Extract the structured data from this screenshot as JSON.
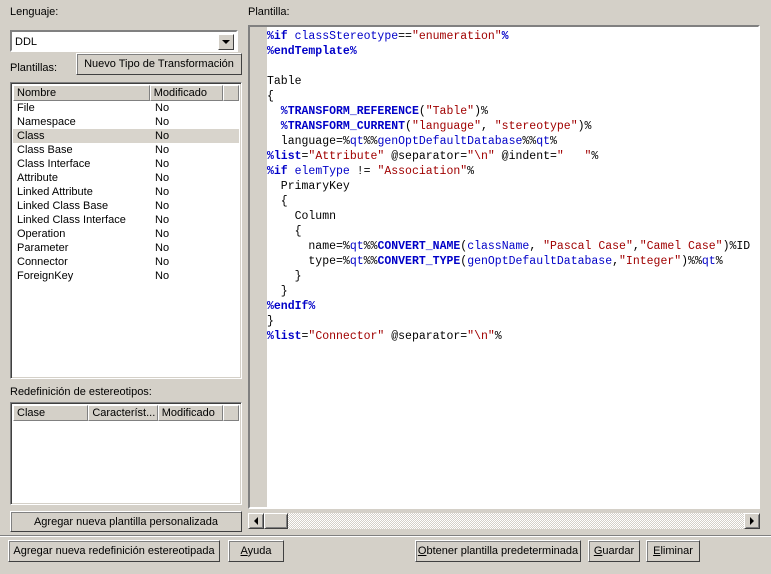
{
  "window": {
    "background_color": "#d4d0c8",
    "accent_text_color": "#000000"
  },
  "left_panel": {
    "language_label": "Lenguaje:",
    "language_combo": {
      "value": "DDL",
      "placeholder": "",
      "arrow_icon": "chevron-down-icon"
    },
    "templates_label": "Plantillas:",
    "new_transform_type_button": "Nuevo Tipo de Transformación",
    "templates_list": {
      "columns": [
        "Nombre",
        "Modificado",
        ""
      ],
      "selected_index": 2,
      "rows": [
        {
          "name": "File",
          "modified": "No"
        },
        {
          "name": "Namespace",
          "modified": "No"
        },
        {
          "name": "Class",
          "modified": "No"
        },
        {
          "name": "Class Base",
          "modified": "No"
        },
        {
          "name": "Class Interface",
          "modified": "No"
        },
        {
          "name": "Attribute",
          "modified": "No"
        },
        {
          "name": "Linked Attribute",
          "modified": "No"
        },
        {
          "name": "Linked Class Base",
          "modified": "No"
        },
        {
          "name": "Linked Class Interface",
          "modified": "No"
        },
        {
          "name": "Operation",
          "modified": "No"
        },
        {
          "name": "Parameter",
          "modified": "No"
        },
        {
          "name": "Connector",
          "modified": "No"
        },
        {
          "name": "ForeignKey",
          "modified": "No"
        }
      ]
    },
    "stereotype_label": "Redefinición de estereotipos:",
    "stereotype_list": {
      "columns": [
        "Clase",
        "Característ...",
        "Modificado",
        ""
      ],
      "rows": []
    },
    "add_custom_template_button": "Agregar nueva plantilla personalizada"
  },
  "right_panel": {
    "template_label": "Plantilla:",
    "editor": {
      "lines": [
        [
          {
            "t": "%if ",
            "c": "kw"
          },
          {
            "t": "classStereotype",
            "c": "var"
          },
          {
            "t": "==",
            "c": "pl"
          },
          {
            "t": "\"enumeration\"",
            "c": "str"
          },
          {
            "t": "%",
            "c": "kw"
          }
        ],
        [
          {
            "t": "%endTemplate%",
            "c": "kw"
          }
        ],
        [],
        [
          {
            "t": "Table",
            "c": "pl"
          }
        ],
        [
          {
            "t": "{",
            "c": "pl"
          }
        ],
        [
          {
            "t": "  %",
            "c": "kw"
          },
          {
            "t": "TRANSFORM_REFERENCE",
            "c": "fn"
          },
          {
            "t": "(",
            "c": "pl"
          },
          {
            "t": "\"Table\"",
            "c": "str"
          },
          {
            "t": ")%",
            "c": "pl"
          }
        ],
        [
          {
            "t": "  %",
            "c": "kw"
          },
          {
            "t": "TRANSFORM_CURRENT",
            "c": "fn"
          },
          {
            "t": "(",
            "c": "pl"
          },
          {
            "t": "\"language\"",
            "c": "str"
          },
          {
            "t": ", ",
            "c": "pl"
          },
          {
            "t": "\"stereotype\"",
            "c": "str"
          },
          {
            "t": ")%",
            "c": "pl"
          }
        ],
        [
          {
            "t": "  language=%",
            "c": "pl"
          },
          {
            "t": "qt",
            "c": "var"
          },
          {
            "t": "%%",
            "c": "pl"
          },
          {
            "t": "genOptDefaultDatabase",
            "c": "var"
          },
          {
            "t": "%%",
            "c": "pl"
          },
          {
            "t": "qt",
            "c": "var"
          },
          {
            "t": "%",
            "c": "pl"
          }
        ],
        [
          {
            "t": "%list",
            "c": "kw"
          },
          {
            "t": "=",
            "c": "pl"
          },
          {
            "t": "\"Attribute\"",
            "c": "str"
          },
          {
            "t": " @separator=",
            "c": "pl"
          },
          {
            "t": "\"\\n\"",
            "c": "str"
          },
          {
            "t": " @indent=",
            "c": "pl"
          },
          {
            "t": "\"   \"",
            "c": "str"
          },
          {
            "t": "%",
            "c": "pl"
          }
        ],
        [
          {
            "t": "%if ",
            "c": "kw"
          },
          {
            "t": "elemType",
            "c": "var"
          },
          {
            "t": " != ",
            "c": "pl"
          },
          {
            "t": "\"Association\"",
            "c": "str"
          },
          {
            "t": "%",
            "c": "pl"
          }
        ],
        [
          {
            "t": "  PrimaryKey",
            "c": "pl"
          }
        ],
        [
          {
            "t": "  {",
            "c": "pl"
          }
        ],
        [
          {
            "t": "    Column",
            "c": "pl"
          }
        ],
        [
          {
            "t": "    {",
            "c": "pl"
          }
        ],
        [
          {
            "t": "      name=%",
            "c": "pl"
          },
          {
            "t": "qt",
            "c": "var"
          },
          {
            "t": "%%",
            "c": "pl"
          },
          {
            "t": "CONVERT_NAME",
            "c": "fn"
          },
          {
            "t": "(",
            "c": "pl"
          },
          {
            "t": "className",
            "c": "var"
          },
          {
            "t": ", ",
            "c": "pl"
          },
          {
            "t": "\"Pascal Case\"",
            "c": "str"
          },
          {
            "t": ",",
            "c": "pl"
          },
          {
            "t": "\"Camel Case\"",
            "c": "str"
          },
          {
            "t": ")%ID",
            "c": "pl"
          }
        ],
        [
          {
            "t": "      type=%",
            "c": "pl"
          },
          {
            "t": "qt",
            "c": "var"
          },
          {
            "t": "%%",
            "c": "pl"
          },
          {
            "t": "CONVERT_TYPE",
            "c": "fn"
          },
          {
            "t": "(",
            "c": "pl"
          },
          {
            "t": "genOptDefaultDatabase",
            "c": "var"
          },
          {
            "t": ",",
            "c": "pl"
          },
          {
            "t": "\"Integer\"",
            "c": "str"
          },
          {
            "t": ")%%",
            "c": "pl"
          },
          {
            "t": "qt",
            "c": "var"
          },
          {
            "t": "%",
            "c": "pl"
          }
        ],
        [
          {
            "t": "    }",
            "c": "pl"
          }
        ],
        [
          {
            "t": "  }",
            "c": "pl"
          }
        ],
        [
          {
            "t": "%endIf%",
            "c": "kw"
          }
        ],
        [
          {
            "t": "}",
            "c": "pl"
          }
        ],
        [
          {
            "t": "%list",
            "c": "kw"
          },
          {
            "t": "=",
            "c": "pl"
          },
          {
            "t": "\"Connector\"",
            "c": "str"
          },
          {
            "t": " @separator=",
            "c": "pl"
          },
          {
            "t": "\"\\n\"",
            "c": "str"
          },
          {
            "t": "%",
            "c": "pl"
          }
        ]
      ],
      "hscrollbar": {
        "left_arrow_icon": "arrow-left-icon",
        "right_arrow_icon": "arrow-right-icon",
        "thumb_position": 0
      }
    }
  },
  "footer": {
    "add_stereotype_redefinition_button": "Agregar nueva redefinición estereotipada",
    "help_button": "Ayuda",
    "get_default_template_button": "Obtener plantilla predeterminada",
    "save_button": "Guardar",
    "delete_button": "Eliminar"
  }
}
